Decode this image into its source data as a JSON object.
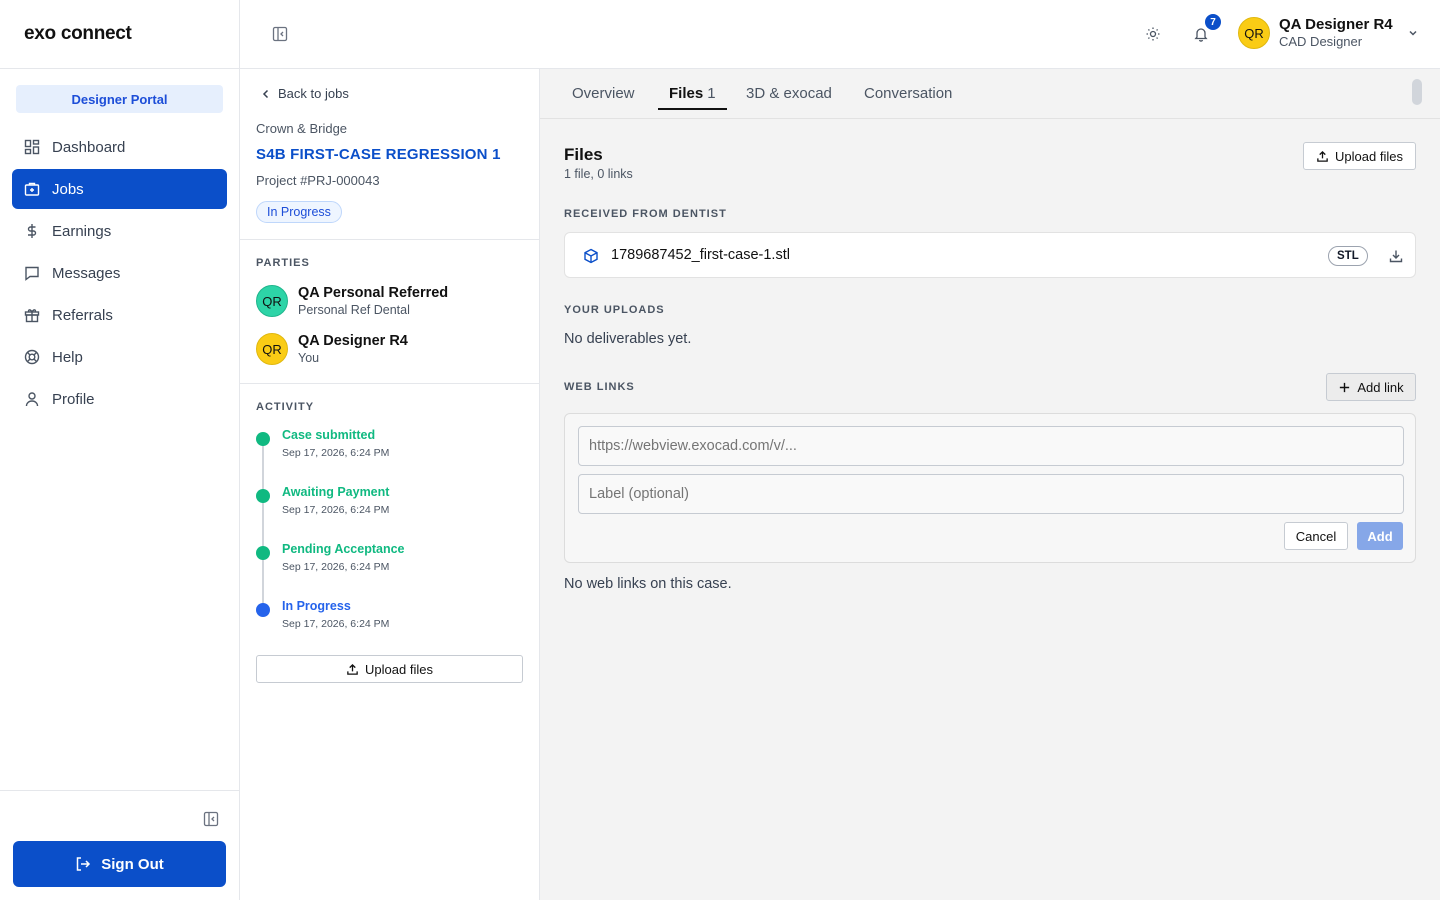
{
  "app": {
    "logo": "exo connect",
    "portal": "Designer Portal"
  },
  "sidebar": {
    "items": [
      {
        "label": "Dashboard",
        "icon": "dashboard-icon"
      },
      {
        "label": "Jobs",
        "icon": "briefcase-icon",
        "active": true
      },
      {
        "label": "Earnings",
        "icon": "dollar-icon"
      },
      {
        "label": "Messages",
        "icon": "message-icon"
      },
      {
        "label": "Referrals",
        "icon": "gift-icon"
      },
      {
        "label": "Help",
        "icon": "lifebuoy-icon"
      },
      {
        "label": "Profile",
        "icon": "user-icon"
      }
    ],
    "sign_out": "Sign Out"
  },
  "header": {
    "notifications": "7",
    "user": {
      "initials": "QR",
      "name": "QA Designer R4",
      "role": "CAD Designer"
    }
  },
  "job": {
    "back": "Back to jobs",
    "category": "Crown & Bridge",
    "title": "S4B FIRST-CASE REGRESSION 1",
    "project": "Project #PRJ-000043",
    "status": "In Progress"
  },
  "parties": {
    "label": "PARTIES",
    "items": [
      {
        "initials": "QR",
        "name": "QA Personal Referred",
        "sub": "Personal Ref Dental",
        "color": "#2dd4a7"
      },
      {
        "initials": "QR",
        "name": "QA Designer R4",
        "sub": "You",
        "color": "#facc15"
      }
    ]
  },
  "activity": {
    "label": "ACTIVITY",
    "items": [
      {
        "title": "Case submitted",
        "date": "Sep 17, 2026, 6:24 PM",
        "color": "#10b981"
      },
      {
        "title": "Awaiting Payment",
        "date": "Sep 17, 2026, 6:24 PM",
        "color": "#10b981"
      },
      {
        "title": "Pending Acceptance",
        "date": "Sep 17, 2026, 6:24 PM",
        "color": "#10b981"
      },
      {
        "title": "In Progress",
        "date": "Sep 17, 2026, 6:24 PM",
        "color": "#2563eb"
      }
    ],
    "upload": "Upload files"
  },
  "tabs": [
    {
      "label": "Overview"
    },
    {
      "label": "Files",
      "count": "1",
      "active": true
    },
    {
      "label": "3D & exocad"
    },
    {
      "label": "Conversation"
    }
  ],
  "files": {
    "title": "Files",
    "summary": "1 file, 0 links",
    "upload": "Upload files",
    "received_label": "RECEIVED FROM DENTIST",
    "received": [
      {
        "name": "1789687452_first-case-1.stl",
        "type": "STL"
      }
    ],
    "uploads_label": "YOUR UPLOADS",
    "uploads_empty": "No deliverables yet.",
    "links_label": "WEB LINKS",
    "add_link": "Add link",
    "url_placeholder": "https://webview.exocad.com/v/...",
    "label_placeholder": "Label (optional)",
    "cancel": "Cancel",
    "add": "Add",
    "links_empty": "No web links on this case."
  }
}
